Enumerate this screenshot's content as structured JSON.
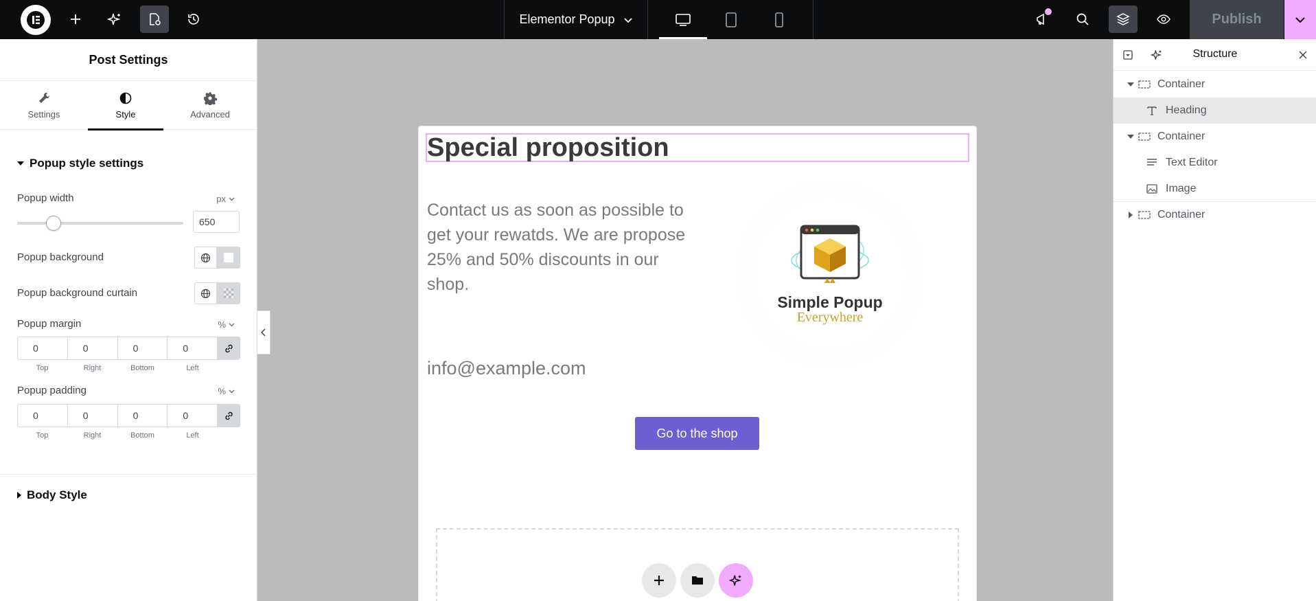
{
  "topbar": {
    "doc_title": "Elementor Popup",
    "publish_label": "Publish",
    "icons": [
      "elementor-logo-icon",
      "add-icon",
      "ai-sparkle-icon",
      "page-settings-icon",
      "history-icon",
      "desktop-icon",
      "tablet-icon",
      "mobile-icon",
      "announcements-icon",
      "search-icon",
      "structure-icon",
      "preview-icon",
      "chevron-down-icon"
    ]
  },
  "left_panel": {
    "title": "Post Settings",
    "tabs": [
      {
        "label": "Settings",
        "icon": "wrench-icon"
      },
      {
        "label": "Style",
        "icon": "contrast-icon"
      },
      {
        "label": "Advanced",
        "icon": "gear-icon"
      }
    ],
    "section_popup_style": "Popup style settings",
    "popup_width": {
      "label": "Popup width",
      "unit": "px",
      "value": "650",
      "slider_fraction": 0.19
    },
    "popup_background": {
      "label": "Popup background"
    },
    "popup_background_curtain": {
      "label": "Popup background curtain"
    },
    "popup_margin": {
      "label": "Popup margin",
      "unit": "%",
      "values": [
        "0",
        "0",
        "0",
        "0"
      ]
    },
    "popup_padding": {
      "label": "Popup padding",
      "unit": "%",
      "values": [
        "0",
        "0",
        "0",
        "0"
      ]
    },
    "dim_labels": [
      "Top",
      "Right",
      "Bottom",
      "Left"
    ],
    "section_body_style": "Body Style"
  },
  "popup": {
    "heading": "Special proposition",
    "text": "Contact us as soon as possible to get your rewatds. We are propose 25% and 50% discounts in our shop.",
    "email": "info@example.com",
    "image_text_line1": "Simple Popup",
    "image_text_line2": "Everywhere",
    "button_label": "Go to the shop"
  },
  "structure": {
    "title": "Structure",
    "items": [
      {
        "label": "Container",
        "type": "container",
        "expanded": true,
        "level": 0
      },
      {
        "label": "Heading",
        "type": "heading",
        "level": 1,
        "selected": true
      },
      {
        "label": "Container",
        "type": "container",
        "expanded": true,
        "level": 0
      },
      {
        "label": "Text Editor",
        "type": "text-editor",
        "level": 1
      },
      {
        "label": "Image",
        "type": "image",
        "level": 1
      },
      {
        "label": "Container",
        "type": "container",
        "expanded": false,
        "level": 0
      }
    ]
  },
  "colors": {
    "accent_pink": "#f0abfc",
    "button_purple": "#6b5fd2",
    "topbar_bg": "#0c0d0e",
    "canvas_bg": "#bbbbbc"
  }
}
